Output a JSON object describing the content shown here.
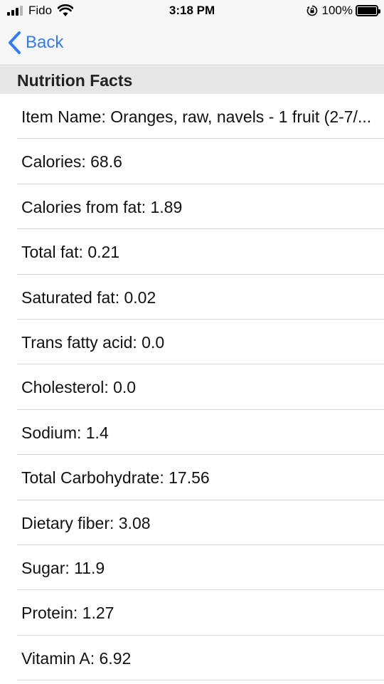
{
  "status_bar": {
    "carrier": "Fido",
    "time": "3:18 PM",
    "battery_percent": "100%",
    "battery_level": 1.0
  },
  "nav": {
    "back_label": "Back"
  },
  "section": {
    "title": "Nutrition Facts"
  },
  "rows": [
    {
      "label": "Item Name: Oranges, raw, navels - 1 fruit (2-7/..."
    },
    {
      "label": "Calories: 68.6"
    },
    {
      "label": "Calories from fat: 1.89"
    },
    {
      "label": "Total fat: 0.21"
    },
    {
      "label": "Saturated fat: 0.02"
    },
    {
      "label": "Trans fatty acid: 0.0"
    },
    {
      "label": "Cholesterol: 0.0"
    },
    {
      "label": "Sodium: 1.4"
    },
    {
      "label": "Total Carbohydrate: 17.56"
    },
    {
      "label": "Dietary fiber: 3.08"
    },
    {
      "label": "Sugar: 11.9"
    },
    {
      "label": "Protein: 1.27"
    },
    {
      "label": "Vitamin A: 6.92"
    }
  ],
  "colors": {
    "accent": "#2f7cf6",
    "nav_background": "#f7f7f7",
    "section_background": "#e6e6e6",
    "separator": "#d9d9d9"
  },
  "icons": [
    "signal-icon",
    "wifi-icon",
    "rotation-lock-icon",
    "battery-icon",
    "chevron-left-icon"
  ]
}
